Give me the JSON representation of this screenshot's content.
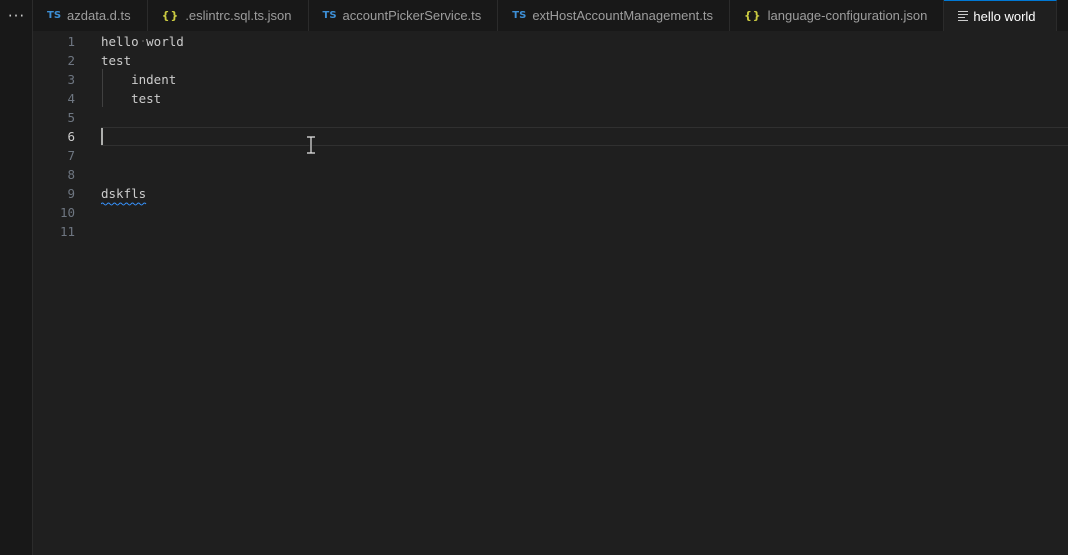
{
  "activity": {
    "more_icon": "ellipsis-icon",
    "more_glyph": "···"
  },
  "tabs": [
    {
      "icon": "ts",
      "label": "azdata.d.ts"
    },
    {
      "icon": "json",
      "label": ".eslintrc.sql.ts.json"
    },
    {
      "icon": "ts",
      "label": "accountPickerService.ts"
    },
    {
      "icon": "ts",
      "label": "extHostAccountManagement.ts"
    },
    {
      "icon": "json",
      "label": "language-configuration.json"
    },
    {
      "icon": "text",
      "label": "hello world"
    }
  ],
  "icon_glyphs": {
    "ts": "TS",
    "json": "{}"
  },
  "editor": {
    "current_line": 6,
    "lines": [
      {
        "number": "1",
        "text": "hello world"
      },
      {
        "number": "2",
        "text": "test"
      },
      {
        "number": "3",
        "text": "    indent"
      },
      {
        "number": "4",
        "text": "    test"
      },
      {
        "number": "5",
        "text": ""
      },
      {
        "number": "6",
        "text": ""
      },
      {
        "number": "7",
        "text": ""
      },
      {
        "number": "8",
        "text": ""
      },
      {
        "number": "9",
        "text": "dskfls"
      },
      {
        "number": "10",
        "text": ""
      },
      {
        "number": "11",
        "text": ""
      }
    ]
  },
  "colors": {
    "background": "#1f1f1f",
    "tab_bar": "#181818",
    "active_tab_border": "#0078d4",
    "ts_icon": "#3d8fd6",
    "json_icon": "#cbcb41",
    "line_number": "#6e7681",
    "spelling_squiggle": "#3794ff"
  }
}
